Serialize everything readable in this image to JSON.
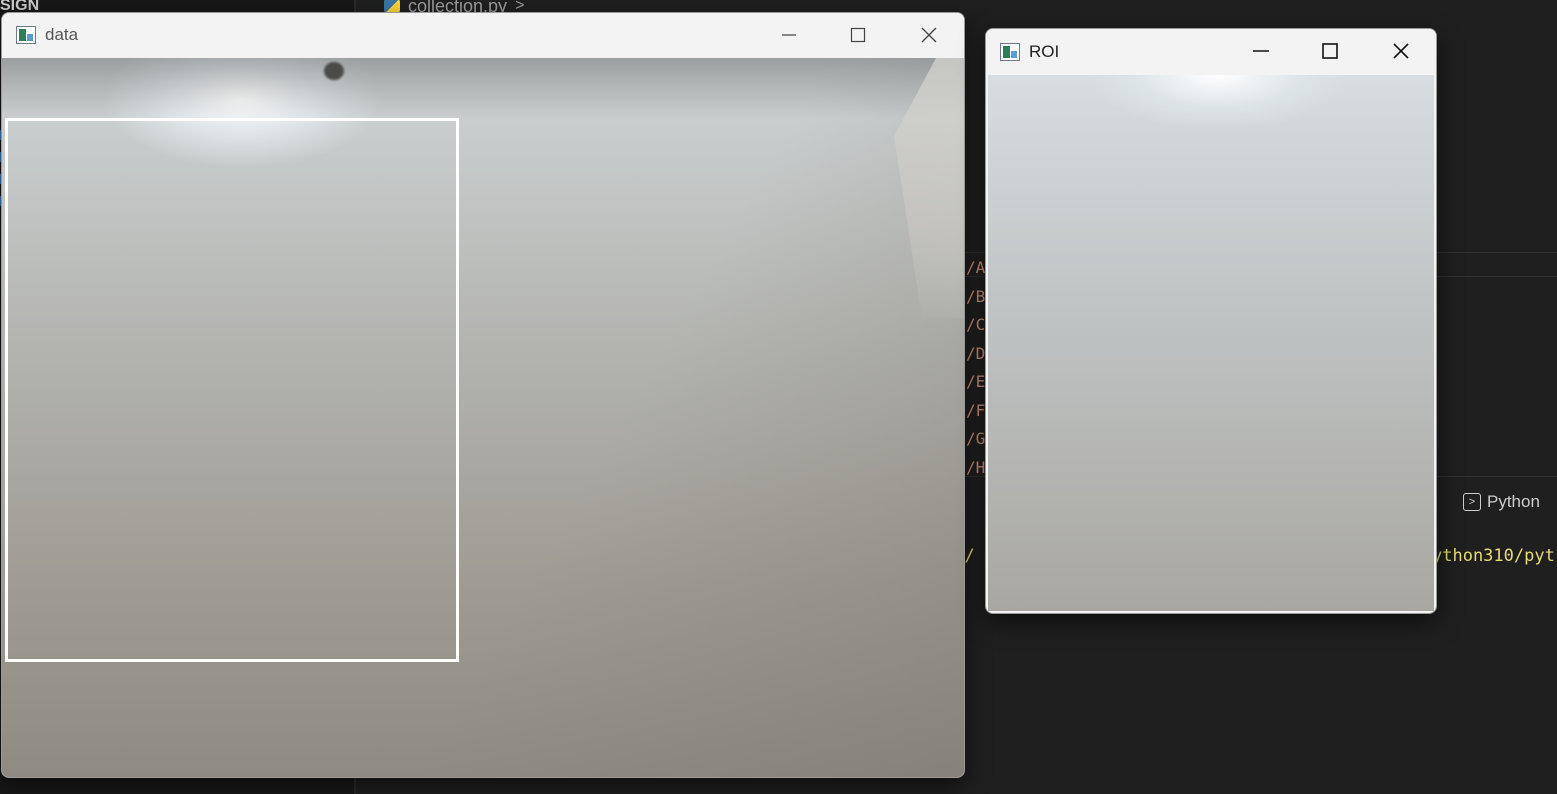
{
  "ide": {
    "sidebar_title": "SIGN",
    "tab_label": "collection.py",
    "tab_chevron": ">",
    "code_lines": [
      "/A",
      "/B",
      "/C",
      "/D",
      "/E",
      "/F",
      "/G",
      "/H"
    ],
    "terminal_label": "Python",
    "terminal_left_text": "rs/",
    "terminal_right_text": "ython310/pyt"
  },
  "windows": {
    "data": {
      "title": "data"
    },
    "roi": {
      "title": "ROI"
    }
  },
  "icons": {
    "minimize": "minimize-icon",
    "maximize": "maximize-icon",
    "close": "close-icon",
    "app": "opencv-app-icon",
    "python_file": "python-file-icon",
    "terminal": "terminal-icon"
  }
}
